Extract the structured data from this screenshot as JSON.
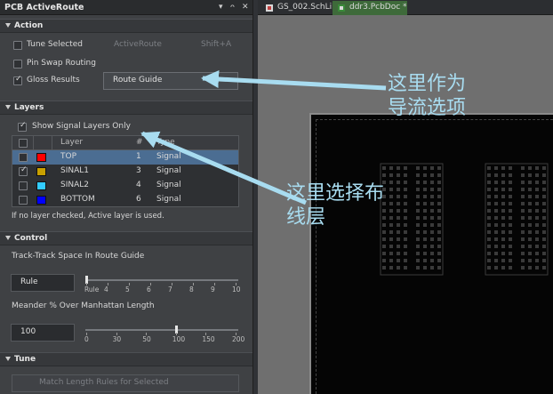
{
  "panel": {
    "title": "PCB ActiveRoute",
    "pin_glyph": "ᴖ",
    "close_glyph": "✕",
    "dropdown_glyph": "▾"
  },
  "tabs": [
    {
      "label": "GS_002.SchLib",
      "active": false
    },
    {
      "label": "ddr3.PcbDoc *",
      "active": true
    }
  ],
  "action": {
    "header": "Action",
    "tune_selected": "Tune Selected",
    "activeroute_button": "ActiveRoute",
    "shortcut": "Shift+A",
    "pin_swap": "Pin Swap Routing",
    "gloss_results": "Gloss Results",
    "route_guide_button": "Route Guide"
  },
  "layers": {
    "header": "Layers",
    "show_signal_only": "Show Signal Layers Only",
    "columns": {
      "layer": "Layer",
      "num": "#",
      "type": "Type"
    },
    "rows": [
      {
        "name": "TOP",
        "num": "1",
        "type": "Signal",
        "color": "#ff0000",
        "checked": false,
        "selected": true
      },
      {
        "name": "SINAL1",
        "num": "3",
        "type": "Signal",
        "color": "#c8a000",
        "checked": true,
        "selected": false
      },
      {
        "name": "SINAL2",
        "num": "4",
        "type": "Signal",
        "color": "#33ccff",
        "checked": false,
        "selected": false
      },
      {
        "name": "BOTTOM",
        "num": "6",
        "type": "Signal",
        "color": "#0000ff",
        "checked": false,
        "selected": false
      }
    ],
    "hint": "If no layer checked, Active layer is used."
  },
  "control": {
    "header": "Control",
    "track_label": "Track-Track Space In Route Guide",
    "track_value": "Rule",
    "track_ticks": [
      "Rule",
      "4",
      "5",
      "6",
      "7",
      "8",
      "9",
      "10"
    ],
    "track_level": 0,
    "meander_label": "Meander % Over Manhattan Length",
    "meander_value": "100",
    "meander_ticks": [
      "0",
      "30",
      "50",
      "100",
      "150",
      "200"
    ],
    "meander_level": 100
  },
  "tune": {
    "header": "Tune",
    "match_length": "Match Length Rules for Selected"
  },
  "annotations": {
    "note1_line1": "这里作为",
    "note1_line2": "导流选项",
    "note2_line1": "这里选择布",
    "note2_line2": "线层",
    "color": "#a8dcf0"
  }
}
